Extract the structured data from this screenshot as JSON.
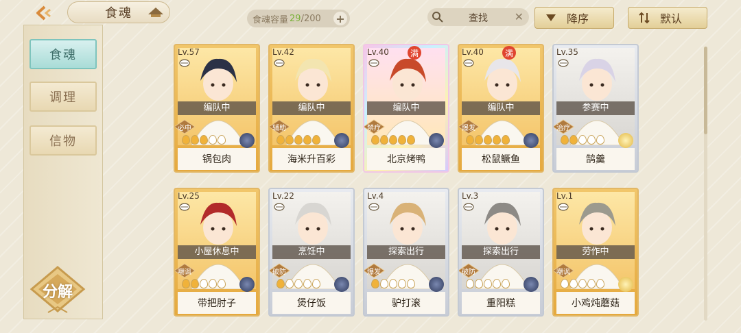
{
  "header": {
    "title": "食魂",
    "capacity_label": "食魂容量",
    "capacity_current": "29",
    "capacity_max": "/200",
    "search_text": "查找",
    "sort_label": "降序",
    "default_label": "默认"
  },
  "sidebar": {
    "tabs": [
      {
        "label": "食魂",
        "active": true
      },
      {
        "label": "调理",
        "active": false
      },
      {
        "label": "信物",
        "active": false
      }
    ],
    "decompose_label": "分解"
  },
  "cards": [
    {
      "level": "Lv.57",
      "status": "编队中",
      "role": "必中",
      "name": "锅包肉",
      "frame": "gold",
      "max": false,
      "pips": 3,
      "orb": "dark-blue"
    },
    {
      "level": "Lv.42",
      "status": "编队中",
      "role": "辅助",
      "name": "海米升百彩",
      "frame": "gold",
      "max": false,
      "pips": 5,
      "orb": "dark-blue"
    },
    {
      "level": "Lv.40",
      "status": "编队中",
      "role": "禁疗",
      "name": "北京烤鸭",
      "frame": "rainbow",
      "max": true,
      "max_label": "满",
      "pips": 5,
      "orb": "dark-blue"
    },
    {
      "level": "Lv.40",
      "status": "编队中",
      "role": "爆发",
      "name": "松鼠鳜鱼",
      "frame": "gold",
      "max": true,
      "max_label": "满",
      "pips": 5,
      "orb": "dark-blue"
    },
    {
      "level": "Lv.35",
      "status": "参赛中",
      "role": "治疗",
      "name": "鹄羹",
      "frame": "silver",
      "max": false,
      "pips": 2,
      "orb": "gold"
    },
    {
      "level": "Lv.25",
      "status": "小屋休息中",
      "role": "嘲讽",
      "name": "带把肘子",
      "frame": "gold",
      "max": false,
      "pips": 2,
      "orb": "dark-blue"
    },
    {
      "level": "Lv.22",
      "status": "烹饪中",
      "role": "破防",
      "name": "煲仔饭",
      "frame": "silver",
      "max": false,
      "pips": 1,
      "orb": "dark-blue"
    },
    {
      "level": "Lv.4",
      "status": "探索出行",
      "role": "爆发",
      "name": "驴打滚",
      "frame": "silver",
      "max": false,
      "pips": 1,
      "orb": "dark-blue"
    },
    {
      "level": "Lv.3",
      "status": "探索出行",
      "role": "破防",
      "name": "重阳糕",
      "frame": "silver",
      "max": false,
      "pips": 0,
      "orb": "dark-blue"
    },
    {
      "level": "Lv.1",
      "status": "劳作中",
      "role": "嘲讽",
      "name": "小鸡炖蘑菇",
      "frame": "gold",
      "max": false,
      "pips": 0,
      "orb": "gold"
    }
  ],
  "colors": {
    "accent_teal": "#a9dcd7",
    "gold": "#e5a93e",
    "capacity_current": "#7bb13a"
  }
}
